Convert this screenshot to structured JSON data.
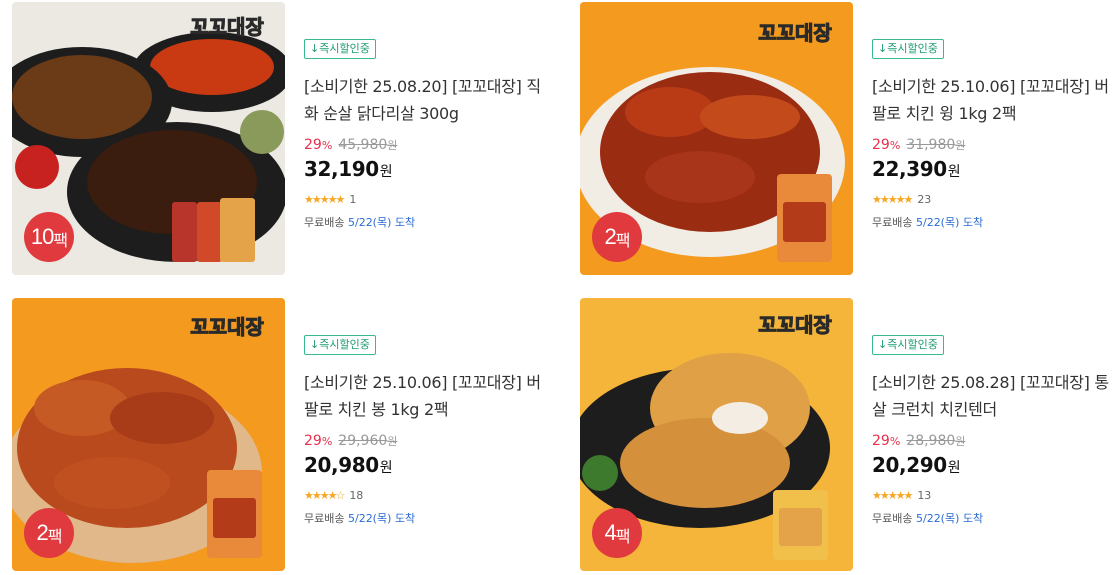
{
  "products": [
    {
      "badge": "↓즉시할인중",
      "title": "[소비기한 25.08.20] [꼬꼬대장] 직화 순살 닭다리살 300g",
      "discount_rate": "29",
      "percent_symbol": "%",
      "original_price": "45,980",
      "price": "32,190",
      "currency": "원",
      "stars": "★★★★★",
      "review_count": "1",
      "shipping": "무료배송",
      "arrival": "5/22(목) 도착",
      "pack_num": "10",
      "pack_unit": "팩",
      "brand_logo": "꼬꼬대장",
      "rating": 5
    },
    {
      "badge": "↓즉시할인중",
      "title": "[소비기한 25.10.06] [꼬꼬대장] 버팔로 치킨 윙 1kg 2팩",
      "discount_rate": "29",
      "percent_symbol": "%",
      "original_price": "31,980",
      "price": "22,390",
      "currency": "원",
      "stars": "★★★★★",
      "review_count": "23",
      "shipping": "무료배송",
      "arrival": "5/22(목) 도착",
      "pack_num": "2",
      "pack_unit": "팩",
      "brand_logo": "꼬꼬대장",
      "rating": 5
    },
    {
      "badge": "↓즉시할인중",
      "title": "[소비기한 25.10.06] [꼬꼬대장] 버팔로 치킨 봉 1kg 2팩",
      "discount_rate": "29",
      "percent_symbol": "%",
      "original_price": "29,960",
      "price": "20,980",
      "currency": "원",
      "stars": "★★★★☆",
      "review_count": "18",
      "shipping": "무료배송",
      "arrival": "5/22(목) 도착",
      "pack_num": "2",
      "pack_unit": "팩",
      "brand_logo": "꼬꼬대장",
      "rating": 4.5
    },
    {
      "badge": "↓즉시할인중",
      "title": "[소비기한 25.08.28] [꼬꼬대장] 통살 크런치 치킨텐더",
      "discount_rate": "29",
      "percent_symbol": "%",
      "original_price": "28,980",
      "price": "20,290",
      "currency": "원",
      "stars": "★★★★★",
      "review_count": "13",
      "shipping": "무료배송",
      "arrival": "5/22(목) 도착",
      "pack_num": "4",
      "pack_unit": "팩",
      "brand_logo": "꼬꼬대장",
      "rating": 5
    }
  ],
  "colors": {
    "discount": "#e5304c",
    "badge_border": "#39b889",
    "arrival": "#2a6bd5",
    "star": "#f5a623",
    "pack_badge": "#e03a3e",
    "orange_bg": "#f39a1f",
    "light_bg": "#ece8e2"
  }
}
